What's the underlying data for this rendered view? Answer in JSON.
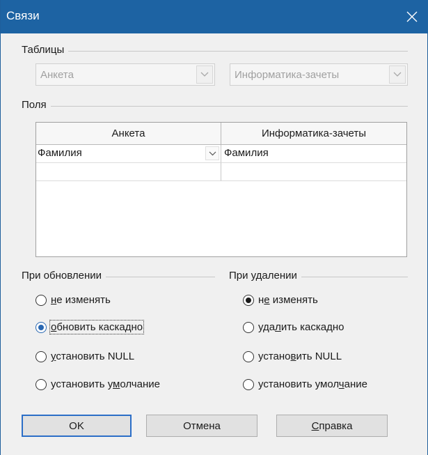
{
  "window": {
    "title": "Связи"
  },
  "tables": {
    "label": "Таблицы",
    "left_table": "Анкета",
    "right_table": "Информатика-зачеты"
  },
  "fields": {
    "label": "Поля",
    "columns": [
      "Анкета",
      "Информатика-зачеты"
    ],
    "rows": [
      [
        "Фамилия",
        "Фамилия"
      ],
      [
        "",
        ""
      ]
    ]
  },
  "on_update": {
    "label": "При обновлении",
    "options": [
      "не изменять",
      "обновить каскадно",
      "установить NULL",
      "установить умолчание"
    ],
    "selected": 1
  },
  "on_delete": {
    "label": "При удалении",
    "options": [
      "не изменять",
      "удалить каскадно",
      "установить NULL",
      "установить умолчание"
    ],
    "selected": 0
  },
  "buttons": {
    "ok": "OK",
    "cancel": "Отмена",
    "help": "Справка"
  }
}
